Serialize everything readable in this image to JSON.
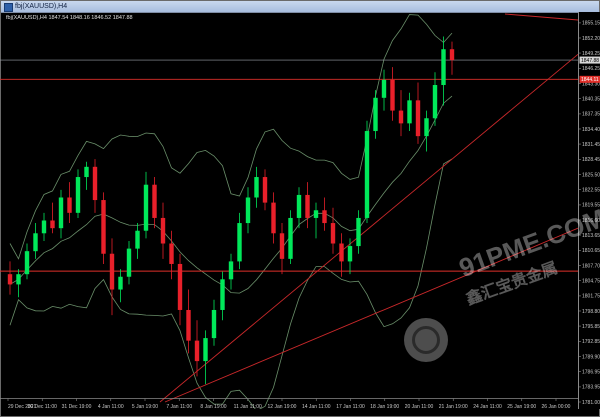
{
  "window": {
    "title": "fbj(XAUUSD),H4",
    "symbol_line": "fbj(XAUUSD),H4  1847.54 1848.16 1846.52 1847.88"
  },
  "price_axis": {
    "labels": [
      "1855.15",
      "1852.20",
      "1849.25",
      "1847.88",
      "1846.25",
      "1843.30",
      "1840.35",
      "1837.35",
      "1834.40",
      "1831.45",
      "1828.45",
      "1825.50",
      "1822.55",
      "1819.55",
      "1816.60",
      "1813.65",
      "1810.65",
      "1807.70",
      "1804.75",
      "1801.75",
      "1798.80",
      "1795.85",
      "1792.85",
      "1789.90",
      "1786.95",
      "1783.95",
      "1781.00"
    ],
    "current_price": "1847.88",
    "level_price": "1844.11"
  },
  "time_axis": {
    "labels": [
      "29 Dec 2021",
      "30 Dec 11:00",
      "31 Dec 19:00",
      "4 Jan 11:00",
      "5 Jan 19:00",
      "7 Jan 11:00",
      "8 Jan 19:00",
      "11 Jan 11:00",
      "12 Jan 19:00",
      "14 Jan 11:00",
      "17 Jan 11:00",
      "18 Jan 19:00",
      "20 Jan 11:00",
      "21 Jan 19:00",
      "24 Jan 11:00",
      "25 Jan 19:00",
      "26 Jan 00:00"
    ]
  },
  "watermark": {
    "brand": "91PME.COM",
    "cn": "鑫汇宝贵金属"
  },
  "colors": {
    "bull": "#00e85a",
    "bear": "#e8202a",
    "band": "#6a8f6a",
    "level": "#e0302a",
    "trend": "#c8282a"
  },
  "chart_data": {
    "type": "candlestick",
    "title": "fbj(XAUUSD),H4",
    "ylim": [
      1781.0,
      1856.5
    ],
    "candles": [
      [
        1806.0,
        1808.5,
        1802.0,
        1804.0
      ],
      [
        1804.0,
        1807.0,
        1801.5,
        1806.0
      ],
      [
        1806.0,
        1812.0,
        1805.0,
        1810.5
      ],
      [
        1810.5,
        1816.0,
        1809.0,
        1814.0
      ],
      [
        1814.0,
        1818.0,
        1812.5,
        1816.5
      ],
      [
        1816.5,
        1820.0,
        1814.0,
        1815.0
      ],
      [
        1815.0,
        1822.5,
        1813.0,
        1821.0
      ],
      [
        1821.0,
        1824.0,
        1816.0,
        1818.0
      ],
      [
        1818.0,
        1826.5,
        1817.0,
        1825.0
      ],
      [
        1825.0,
        1828.0,
        1822.5,
        1827.0
      ],
      [
        1827.0,
        1828.5,
        1818.0,
        1820.5
      ],
      [
        1820.5,
        1822.0,
        1808.0,
        1810.0
      ],
      [
        1810.0,
        1813.0,
        1798.0,
        1803.0
      ],
      [
        1803.0,
        1807.0,
        1800.5,
        1805.5
      ],
      [
        1805.5,
        1812.5,
        1804.0,
        1811.0
      ],
      [
        1811.0,
        1816.0,
        1809.0,
        1814.5
      ],
      [
        1814.5,
        1826.0,
        1813.0,
        1823.5
      ],
      [
        1823.5,
        1825.0,
        1815.0,
        1817.0
      ],
      [
        1817.0,
        1820.0,
        1809.0,
        1812.0
      ],
      [
        1812.0,
        1814.5,
        1805.0,
        1808.0
      ],
      [
        1808.0,
        1810.0,
        1796.0,
        1799.0
      ],
      [
        1799.0,
        1803.0,
        1790.5,
        1793.0
      ],
      [
        1793.0,
        1797.0,
        1786.0,
        1789.0
      ],
      [
        1789.0,
        1795.0,
        1784.5,
        1793.5
      ],
      [
        1793.5,
        1801.0,
        1792.0,
        1799.0
      ],
      [
        1799.0,
        1806.5,
        1797.0,
        1805.0
      ],
      [
        1805.0,
        1810.0,
        1803.0,
        1808.5
      ],
      [
        1808.5,
        1818.0,
        1807.0,
        1816.0
      ],
      [
        1816.0,
        1823.0,
        1814.0,
        1821.0
      ],
      [
        1821.0,
        1827.0,
        1819.0,
        1825.0
      ],
      [
        1825.0,
        1826.5,
        1818.5,
        1820.0
      ],
      [
        1820.0,
        1822.0,
        1812.0,
        1814.0
      ],
      [
        1814.0,
        1816.0,
        1806.0,
        1809.0
      ],
      [
        1809.0,
        1818.5,
        1808.0,
        1817.0
      ],
      [
        1817.0,
        1823.0,
        1815.0,
        1821.5
      ],
      [
        1821.5,
        1824.0,
        1815.0,
        1817.0
      ],
      [
        1817.0,
        1820.0,
        1813.0,
        1818.5
      ],
      [
        1818.5,
        1821.0,
        1814.5,
        1816.0
      ],
      [
        1816.0,
        1819.0,
        1810.0,
        1812.0
      ],
      [
        1812.0,
        1814.0,
        1805.5,
        1808.5
      ],
      [
        1808.5,
        1813.0,
        1806.0,
        1811.5
      ],
      [
        1811.5,
        1818.5,
        1810.0,
        1817.0
      ],
      [
        1817.0,
        1836.0,
        1816.0,
        1834.0
      ],
      [
        1834.0,
        1842.0,
        1832.5,
        1840.5
      ],
      [
        1840.5,
        1846.0,
        1838.0,
        1844.0
      ],
      [
        1844.0,
        1846.5,
        1836.0,
        1838.0
      ],
      [
        1838.0,
        1842.0,
        1833.0,
        1835.5
      ],
      [
        1835.5,
        1841.5,
        1834.0,
        1840.0
      ],
      [
        1840.0,
        1843.5,
        1831.5,
        1833.0
      ],
      [
        1833.0,
        1838.0,
        1830.0,
        1836.5
      ],
      [
        1836.5,
        1845.5,
        1835.0,
        1843.0
      ],
      [
        1843.0,
        1852.5,
        1839.0,
        1850.0
      ],
      [
        1850.0,
        1851.5,
        1845.0,
        1847.88
      ]
    ]
  }
}
